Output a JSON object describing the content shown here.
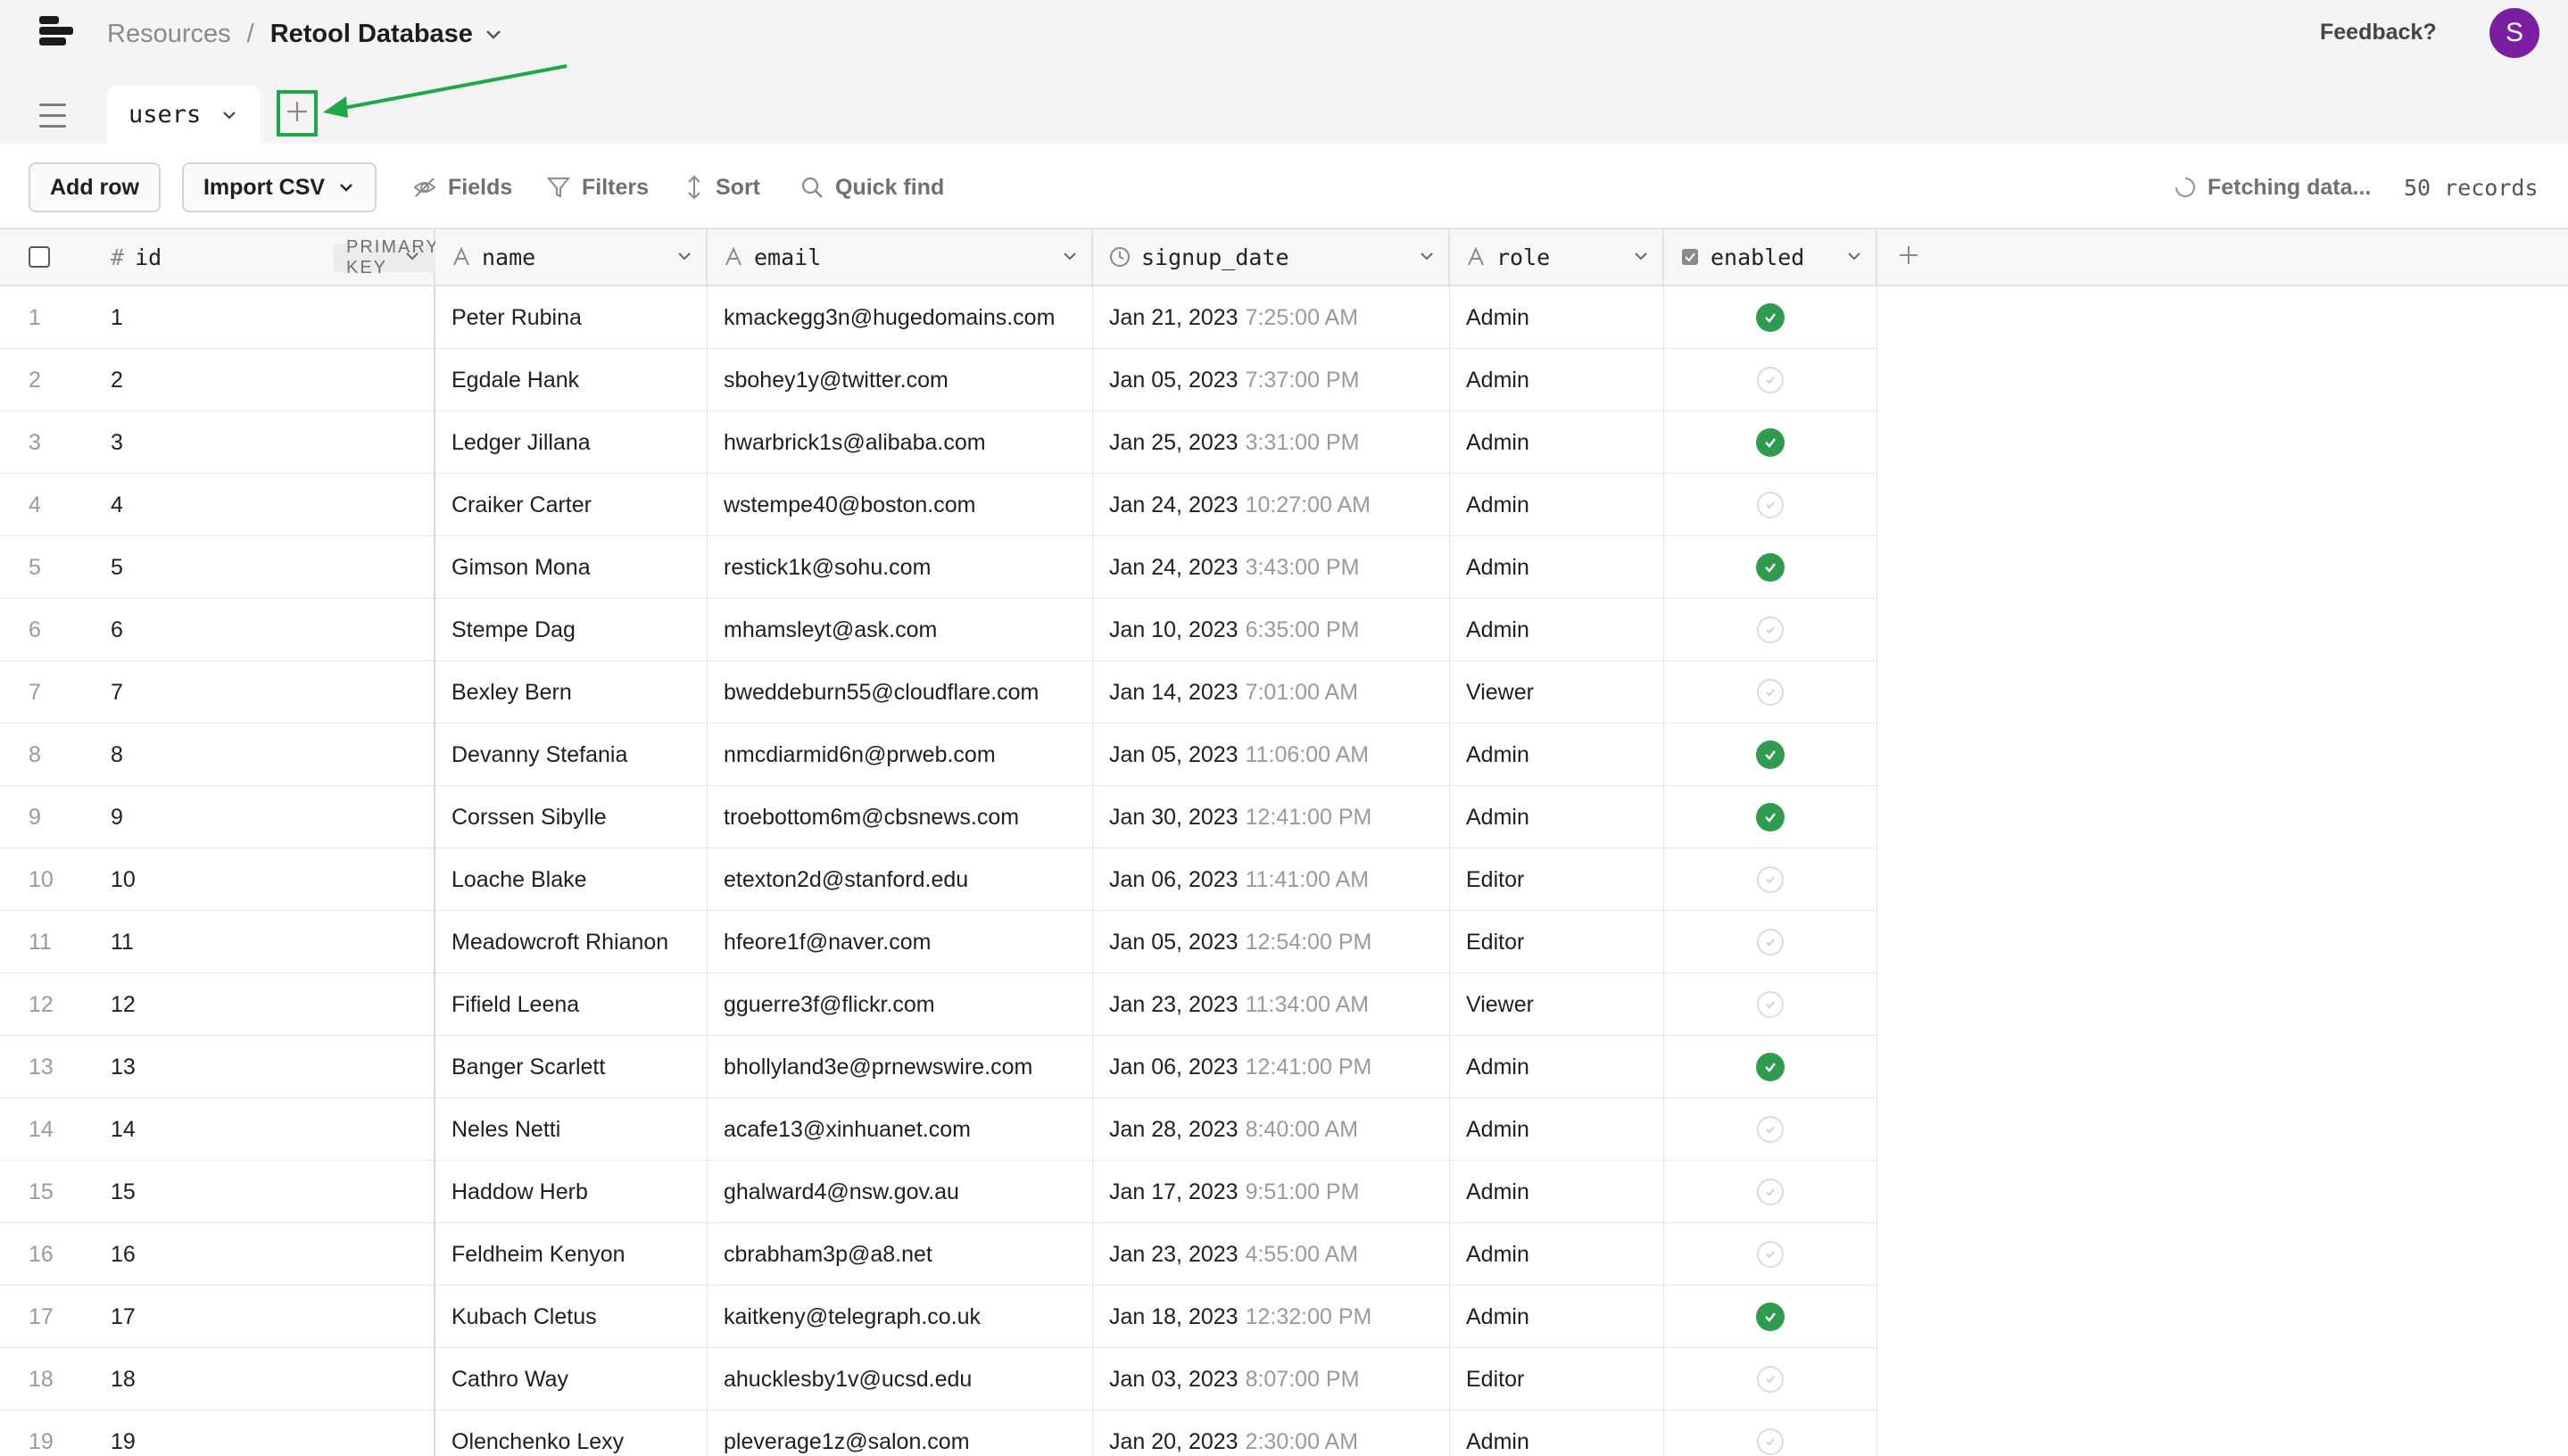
{
  "header": {
    "breadcrumb_root": "Resources",
    "breadcrumb_separator": "/",
    "breadcrumb_current": "Retool Database",
    "feedback_label": "Feedback?",
    "avatar_initial": "S",
    "avatar_color": "#7a1fa2"
  },
  "tabs": {
    "active_table": "users",
    "add_tab_icon": "plus-icon",
    "highlight_color": "#1ea84a"
  },
  "toolbar": {
    "add_row_label": "Add row",
    "import_csv_label": "Import CSV",
    "fields_label": "Fields",
    "filters_label": "Filters",
    "sort_label": "Sort",
    "quick_find_label": "Quick find",
    "status_label": "Fetching data...",
    "records_label": "50 records"
  },
  "columns": {
    "id": {
      "label": "id",
      "badge": "PRIMARY KEY",
      "type_icon": "hash-icon"
    },
    "name": {
      "label": "name",
      "type_icon": "text-type-icon"
    },
    "email": {
      "label": "email",
      "type_icon": "text-type-icon"
    },
    "signup_date": {
      "label": "signup_date",
      "type_icon": "clock-icon"
    },
    "role": {
      "label": "role",
      "type_icon": "text-type-icon"
    },
    "enabled": {
      "label": "enabled",
      "type_icon": "checkbox-type-icon"
    }
  },
  "rows": [
    {
      "n": "1",
      "id": "1",
      "name": "Peter Rubina",
      "email": "kmackegg3n@hugedomains.com",
      "date": "Jan 21, 2023",
      "time": "7:25:00 AM",
      "role": "Admin",
      "enabled": true
    },
    {
      "n": "2",
      "id": "2",
      "name": "Egdale Hank",
      "email": "sbohey1y@twitter.com",
      "date": "Jan 05, 2023",
      "time": "7:37:00 PM",
      "role": "Admin",
      "enabled": false
    },
    {
      "n": "3",
      "id": "3",
      "name": "Ledger Jillana",
      "email": "hwarbrick1s@alibaba.com",
      "date": "Jan 25, 2023",
      "time": "3:31:00 PM",
      "role": "Admin",
      "enabled": true
    },
    {
      "n": "4",
      "id": "4",
      "name": "Craiker Carter",
      "email": "wstempe40@boston.com",
      "date": "Jan 24, 2023",
      "time": "10:27:00 AM",
      "role": "Admin",
      "enabled": false
    },
    {
      "n": "5",
      "id": "5",
      "name": "Gimson Mona",
      "email": "restick1k@sohu.com",
      "date": "Jan 24, 2023",
      "time": "3:43:00 PM",
      "role": "Admin",
      "enabled": true
    },
    {
      "n": "6",
      "id": "6",
      "name": "Stempe Dag",
      "email": "mhamsleyt@ask.com",
      "date": "Jan 10, 2023",
      "time": "6:35:00 PM",
      "role": "Admin",
      "enabled": false
    },
    {
      "n": "7",
      "id": "7",
      "name": "Bexley Bern",
      "email": "bweddeburn55@cloudflare.com",
      "date": "Jan 14, 2023",
      "time": "7:01:00 AM",
      "role": "Viewer",
      "enabled": false
    },
    {
      "n": "8",
      "id": "8",
      "name": "Devanny Stefania",
      "email": "nmcdiarmid6n@prweb.com",
      "date": "Jan 05, 2023",
      "time": "11:06:00 AM",
      "role": "Admin",
      "enabled": true
    },
    {
      "n": "9",
      "id": "9",
      "name": "Corssen Sibylle",
      "email": "troebottom6m@cbsnews.com",
      "date": "Jan 30, 2023",
      "time": "12:41:00 PM",
      "role": "Admin",
      "enabled": true
    },
    {
      "n": "10",
      "id": "10",
      "name": "Loache Blake",
      "email": "etexton2d@stanford.edu",
      "date": "Jan 06, 2023",
      "time": "11:41:00 AM",
      "role": "Editor",
      "enabled": false
    },
    {
      "n": "11",
      "id": "11",
      "name": "Meadowcroft Rhianon",
      "email": "hfeore1f@naver.com",
      "date": "Jan 05, 2023",
      "time": "12:54:00 PM",
      "role": "Editor",
      "enabled": false
    },
    {
      "n": "12",
      "id": "12",
      "name": "Fifield Leena",
      "email": "gguerre3f@flickr.com",
      "date": "Jan 23, 2023",
      "time": "11:34:00 AM",
      "role": "Viewer",
      "enabled": false
    },
    {
      "n": "13",
      "id": "13",
      "name": "Banger Scarlett",
      "email": "bhollyland3e@prnewswire.com",
      "date": "Jan 06, 2023",
      "time": "12:41:00 PM",
      "role": "Admin",
      "enabled": true
    },
    {
      "n": "14",
      "id": "14",
      "name": "Neles Netti",
      "email": "acafe13@xinhuanet.com",
      "date": "Jan 28, 2023",
      "time": "8:40:00 AM",
      "role": "Admin",
      "enabled": false
    },
    {
      "n": "15",
      "id": "15",
      "name": "Haddow Herb",
      "email": "ghalward4@nsw.gov.au",
      "date": "Jan 17, 2023",
      "time": "9:51:00 PM",
      "role": "Admin",
      "enabled": false
    },
    {
      "n": "16",
      "id": "16",
      "name": "Feldheim Kenyon",
      "email": "cbrabham3p@a8.net",
      "date": "Jan 23, 2023",
      "time": "4:55:00 AM",
      "role": "Admin",
      "enabled": false
    },
    {
      "n": "17",
      "id": "17",
      "name": "Kubach Cletus",
      "email": "kaitkeny@telegraph.co.uk",
      "date": "Jan 18, 2023",
      "time": "12:32:00 PM",
      "role": "Admin",
      "enabled": true
    },
    {
      "n": "18",
      "id": "18",
      "name": "Cathro Way",
      "email": "ahucklesby1v@ucsd.edu",
      "date": "Jan 03, 2023",
      "time": "8:07:00 PM",
      "role": "Editor",
      "enabled": false
    },
    {
      "n": "19",
      "id": "19",
      "name": "Olenchenko Lexy",
      "email": "pleverage1z@salon.com",
      "date": "Jan 20, 2023",
      "time": "2:30:00 AM",
      "role": "Admin",
      "enabled": false
    }
  ]
}
